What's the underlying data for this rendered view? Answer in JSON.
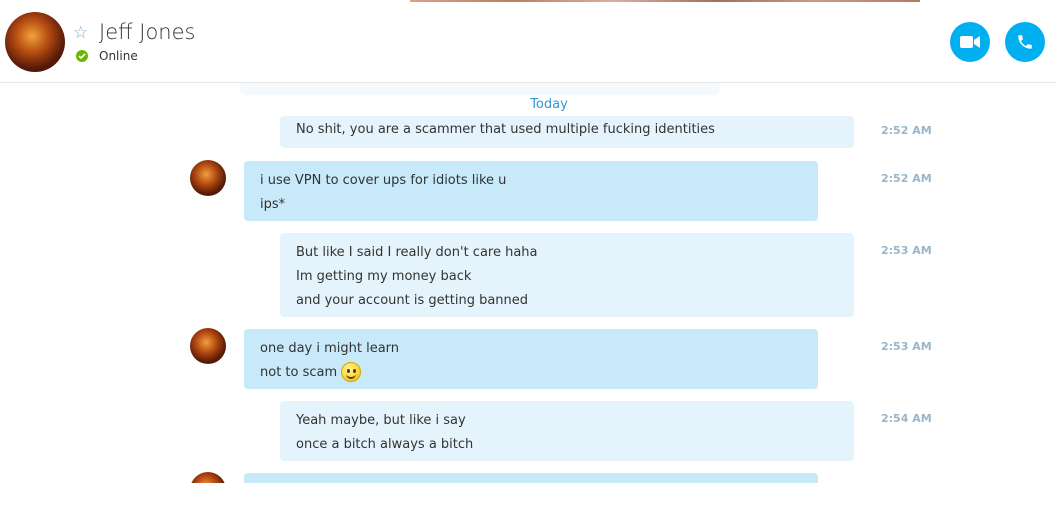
{
  "contact": {
    "name": "Jeff Jones",
    "status": "Online",
    "status_color": "#6bb700",
    "favorite_icon": "star-outline-icon"
  },
  "actions": {
    "video_icon": "video-camera-icon",
    "call_icon": "phone-icon",
    "accent_color": "#00aff0"
  },
  "chat": {
    "date_separator": "Today",
    "messages": [
      {
        "direction": "outgoing",
        "lines": [
          "No shit, you are a scammer that used multiple fucking identities"
        ],
        "time": "2:52 AM"
      },
      {
        "direction": "incoming",
        "lines": [
          "i use VPN to cover ups for idiots like u",
          "ips*"
        ],
        "time": "2:52 AM"
      },
      {
        "direction": "outgoing",
        "lines": [
          "But like I said I really don't care haha",
          "Im getting my money back",
          "and your account is getting banned"
        ],
        "time": "2:53 AM"
      },
      {
        "direction": "incoming",
        "lines": [
          "one day i might learn",
          "not to scam"
        ],
        "emoji": "smile-emoji-icon",
        "time": "2:53 AM"
      },
      {
        "direction": "outgoing",
        "lines": [
          "Yeah maybe, but like i say",
          "once a bitch always a bitch"
        ],
        "time": "2:54 AM"
      }
    ]
  }
}
